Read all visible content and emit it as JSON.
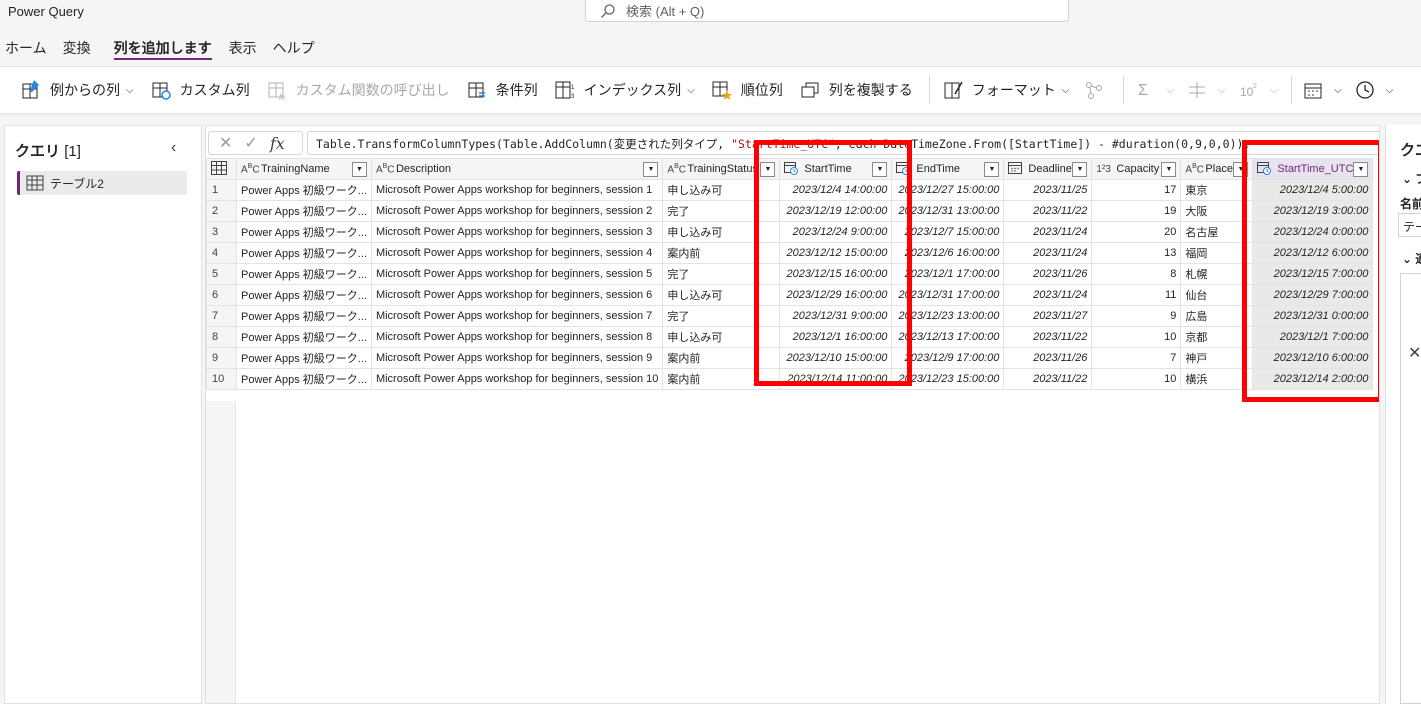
{
  "app": {
    "title": "Power Query"
  },
  "search": {
    "placeholder": "検索 (Alt + Q)"
  },
  "menu": {
    "tabs": [
      "ホーム",
      "変換",
      "列を追加します",
      "表示",
      "ヘルプ"
    ],
    "active_index": 2
  },
  "ribbon": {
    "example_column": "例からの列",
    "custom_column": "カスタム列",
    "invoke_custom_function": "カスタム関数の呼び出し",
    "conditional_column": "条件列",
    "index_column": "インデックス列",
    "rank_column": "順位列",
    "duplicate_column": "列を複製する",
    "format": "フォーマット"
  },
  "queries_pane": {
    "title": "クエリ",
    "count": "[1]",
    "items": [
      "テーブル2"
    ]
  },
  "formula_bar": {
    "prefix": "Table.TransformColumnTypes(Table.AddColumn(変更された列タイプ, ",
    "string_literal": "\"StartTime_UTC\"",
    "suffix": ", each DateTimeZone.From([StartTime]) - #duration(0,9,0,0)),"
  },
  "grid": {
    "columns": [
      {
        "name": "TrainingName",
        "type_icon": "ABC"
      },
      {
        "name": "Description",
        "type_icon": "ABC"
      },
      {
        "name": "TrainingStatus",
        "type_icon": "ABC"
      },
      {
        "name": "StartTime",
        "type_icon": "datetimezone"
      },
      {
        "name": "EndTime",
        "type_icon": "datetimezone"
      },
      {
        "name": "Deadline",
        "type_icon": "date"
      },
      {
        "name": "Capacity",
        "type_icon": "123"
      },
      {
        "name": "Place",
        "type_icon": "ABC"
      },
      {
        "name": "StartTime_UTC",
        "type_icon": "datetimezone"
      }
    ],
    "rows": [
      [
        "1",
        "Power Apps 初級ワーク...",
        "Microsoft Power Apps workshop for beginners, session 1",
        "申し込み可",
        "2023/12/4 14:00:00",
        "2023/12/27 15:00:00",
        "2023/11/25",
        "17",
        "東京",
        "2023/12/4 5:00:00"
      ],
      [
        "2",
        "Power Apps 初級ワーク...",
        "Microsoft Power Apps workshop for beginners, session 2",
        "完了",
        "2023/12/19 12:00:00",
        "2023/12/31 13:00:00",
        "2023/11/22",
        "19",
        "大阪",
        "2023/12/19 3:00:00"
      ],
      [
        "3",
        "Power Apps 初級ワーク...",
        "Microsoft Power Apps workshop for beginners, session 3",
        "申し込み可",
        "2023/12/24 9:00:00",
        "2023/12/7 15:00:00",
        "2023/11/24",
        "20",
        "名古屋",
        "2023/12/24 0:00:00"
      ],
      [
        "4",
        "Power Apps 初級ワーク...",
        "Microsoft Power Apps workshop for beginners, session 4",
        "案内前",
        "2023/12/12 15:00:00",
        "2023/12/6 16:00:00",
        "2023/11/24",
        "13",
        "福岡",
        "2023/12/12 6:00:00"
      ],
      [
        "5",
        "Power Apps 初級ワーク...",
        "Microsoft Power Apps workshop for beginners, session 5",
        "完了",
        "2023/12/15 16:00:00",
        "2023/12/1 17:00:00",
        "2023/11/26",
        "8",
        "札幌",
        "2023/12/15 7:00:00"
      ],
      [
        "6",
        "Power Apps 初級ワーク...",
        "Microsoft Power Apps workshop for beginners, session 6",
        "申し込み可",
        "2023/12/29 16:00:00",
        "2023/12/31 17:00:00",
        "2023/11/24",
        "11",
        "仙台",
        "2023/12/29 7:00:00"
      ],
      [
        "7",
        "Power Apps 初級ワーク...",
        "Microsoft Power Apps workshop for beginners, session 7",
        "完了",
        "2023/12/31 9:00:00",
        "2023/12/23 13:00:00",
        "2023/11/27",
        "9",
        "広島",
        "2023/12/31 0:00:00"
      ],
      [
        "8",
        "Power Apps 初級ワーク...",
        "Microsoft Power Apps workshop for beginners, session 8",
        "申し込み可",
        "2023/12/1 16:00:00",
        "2023/12/13 17:00:00",
        "2023/11/22",
        "10",
        "京都",
        "2023/12/1 7:00:00"
      ],
      [
        "9",
        "Power Apps 初級ワーク...",
        "Microsoft Power Apps workshop for beginners, session 9",
        "案内前",
        "2023/12/10 15:00:00",
        "2023/12/9 17:00:00",
        "2023/11/26",
        "7",
        "神戸",
        "2023/12/10 6:00:00"
      ],
      [
        "10",
        "Power Apps 初級ワーク...",
        "Microsoft Power Apps workshop for beginners, session 10",
        "案内前",
        "2023/12/14 11:00:00",
        "2023/12/23 15:00:00",
        "2023/11/22",
        "10",
        "横浜",
        "2023/12/14 2:00:00"
      ]
    ]
  },
  "right_pane": {
    "title": "クエ",
    "section1": "ブ",
    "name_label": "名前",
    "name_value": "テー",
    "section2": "適"
  },
  "colors": {
    "accent": "#742774",
    "highlight": "#ff0000"
  }
}
